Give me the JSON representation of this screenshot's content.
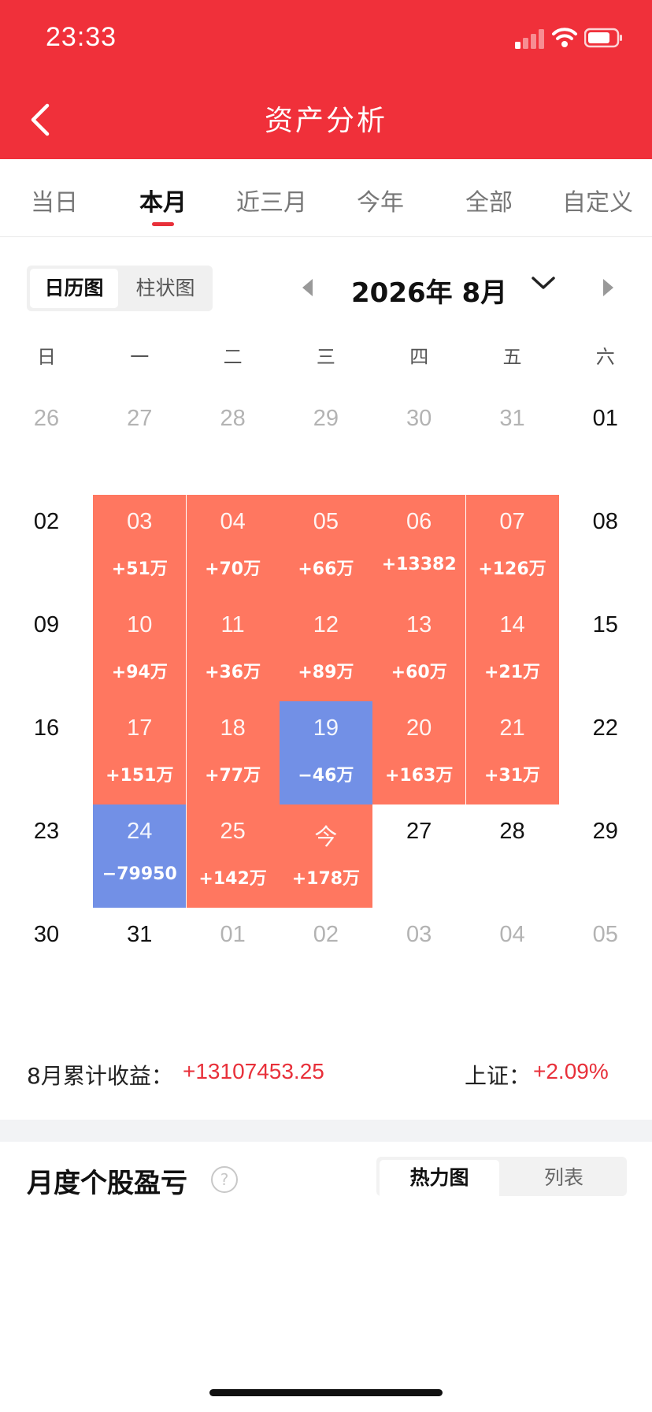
{
  "status_bar": {
    "time": "23:33"
  },
  "header": {
    "title": "资产分析"
  },
  "tabs": [
    {
      "label": "当日",
      "active": false
    },
    {
      "label": "本月",
      "active": true
    },
    {
      "label": "近三月",
      "active": false
    },
    {
      "label": "今年",
      "active": false
    },
    {
      "label": "全部",
      "active": false
    },
    {
      "label": "自定义",
      "active": false
    }
  ],
  "view_toggle": {
    "calendar_label": "日历图",
    "bar_label": "柱状图",
    "active": "calendar"
  },
  "month_nav": {
    "label": "2026年 8月"
  },
  "weekdays": [
    "日",
    "一",
    "二",
    "三",
    "四",
    "五",
    "六"
  ],
  "calendar": {
    "weeks": [
      [
        {
          "day": "26",
          "type": "other"
        },
        {
          "day": "27",
          "type": "other"
        },
        {
          "day": "28",
          "type": "other"
        },
        {
          "day": "29",
          "type": "other"
        },
        {
          "day": "30",
          "type": "other"
        },
        {
          "day": "31",
          "type": "other"
        },
        {
          "day": "01",
          "type": "cur"
        }
      ],
      [
        {
          "day": "02",
          "type": "cur"
        },
        {
          "day": "03",
          "type": "gain",
          "pnl": "+51万"
        },
        {
          "day": "04",
          "type": "gain",
          "pnl": "+70万"
        },
        {
          "day": "05",
          "type": "gain",
          "pnl": "+66万"
        },
        {
          "day": "06",
          "type": "gain",
          "pnl": "+13382"
        },
        {
          "day": "07",
          "type": "gain",
          "pnl": "+126万"
        },
        {
          "day": "08",
          "type": "cur"
        }
      ],
      [
        {
          "day": "09",
          "type": "cur"
        },
        {
          "day": "10",
          "type": "gain",
          "pnl": "+94万"
        },
        {
          "day": "11",
          "type": "gain",
          "pnl": "+36万"
        },
        {
          "day": "12",
          "type": "gain",
          "pnl": "+89万"
        },
        {
          "day": "13",
          "type": "gain",
          "pnl": "+60万"
        },
        {
          "day": "14",
          "type": "gain",
          "pnl": "+21万"
        },
        {
          "day": "15",
          "type": "cur"
        }
      ],
      [
        {
          "day": "16",
          "type": "cur"
        },
        {
          "day": "17",
          "type": "gain",
          "pnl": "+151万"
        },
        {
          "day": "18",
          "type": "gain",
          "pnl": "+77万"
        },
        {
          "day": "19",
          "type": "loss",
          "pnl": "−46万"
        },
        {
          "day": "20",
          "type": "gain",
          "pnl": "+163万"
        },
        {
          "day": "21",
          "type": "gain",
          "pnl": "+31万"
        },
        {
          "day": "22",
          "type": "cur"
        }
      ],
      [
        {
          "day": "23",
          "type": "cur"
        },
        {
          "day": "24",
          "type": "loss",
          "pnl": "−79950"
        },
        {
          "day": "25",
          "type": "gain",
          "pnl": "+142万"
        },
        {
          "day": "今",
          "type": "gain",
          "pnl": "+178万"
        },
        {
          "day": "27",
          "type": "cur"
        },
        {
          "day": "28",
          "type": "cur"
        },
        {
          "day": "29",
          "type": "cur"
        }
      ],
      [
        {
          "day": "30",
          "type": "cur"
        },
        {
          "day": "31",
          "type": "cur"
        },
        {
          "day": "01",
          "type": "other"
        },
        {
          "day": "02",
          "type": "other"
        },
        {
          "day": "03",
          "type": "other"
        },
        {
          "day": "04",
          "type": "other"
        },
        {
          "day": "05",
          "type": "other"
        }
      ]
    ]
  },
  "summary": {
    "label": "8月累计收益：",
    "value": "+13107453.25",
    "index_label": "上证：",
    "index_value": "+2.09%"
  },
  "monthly_section": {
    "title": "月度个股盈亏",
    "help_icon": "?",
    "toggle_heatmap": "热力图",
    "toggle_list": "列表",
    "active": "heatmap"
  },
  "colors": {
    "brand_red": "#f0303a",
    "gain": "#ff7760",
    "loss": "#7290e6",
    "positive_text": "#e8303a"
  }
}
